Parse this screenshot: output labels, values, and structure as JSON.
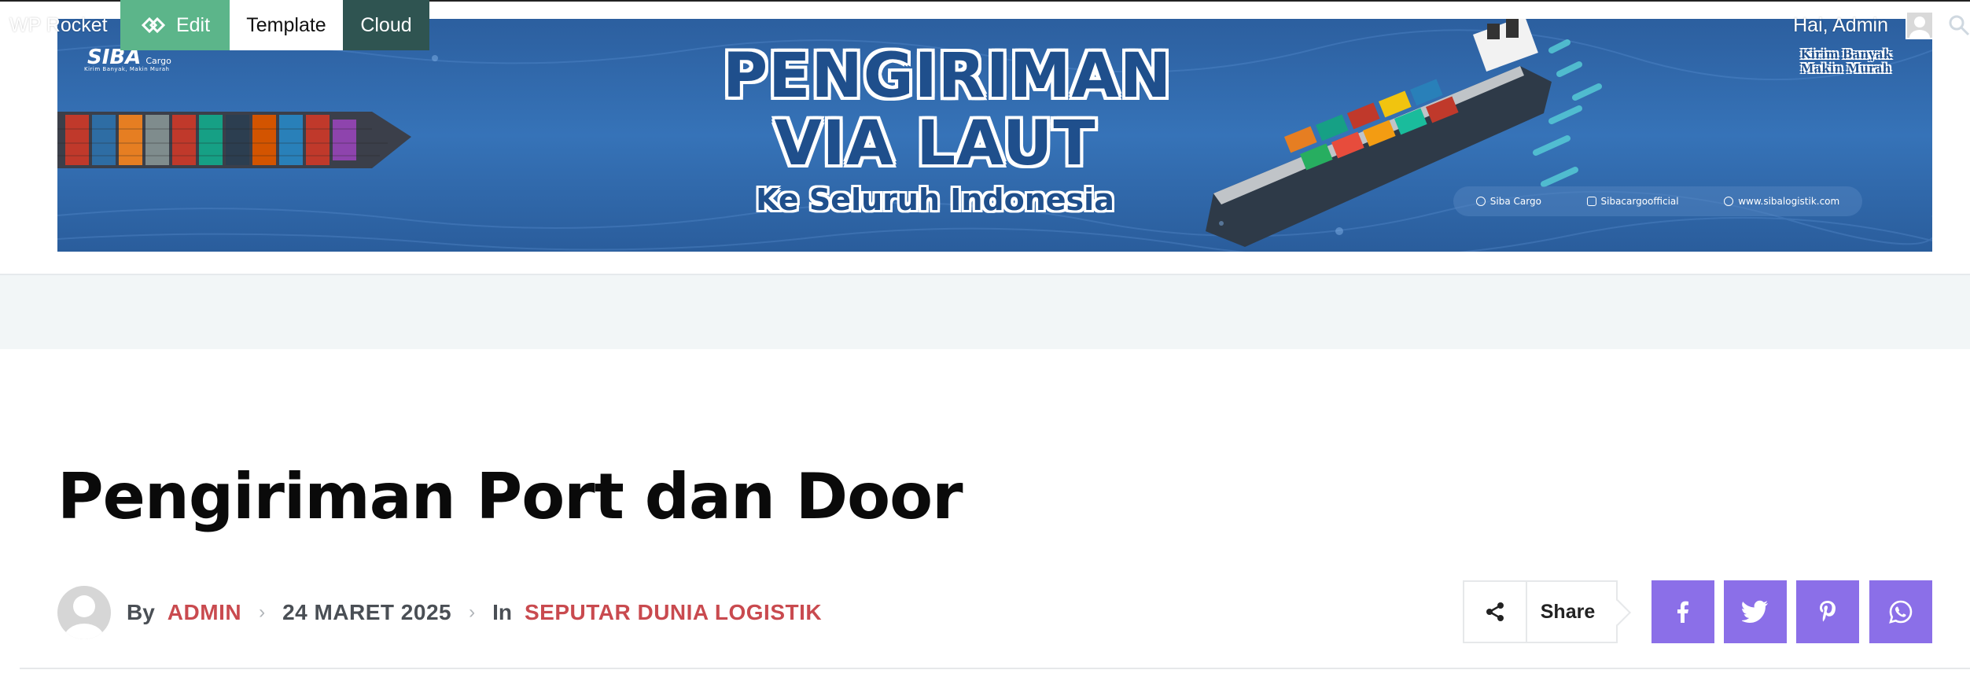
{
  "admin_bar": {
    "wp_rocket_label": "WP Rocket",
    "edit_label": "Edit",
    "template_label": "Template",
    "cloud_label": "Cloud",
    "greeting": "Hai, Admin"
  },
  "banner": {
    "logo_text": "SIBA",
    "logo_sub": "Cargo",
    "logo_tagline": "Kirim Banyak, Makin Murah",
    "title_line1": "PENGIRIMAN",
    "title_line2": "VIA LAUT",
    "subtitle": "Ke Seluruh Indonesia",
    "slogan_line1": "Kirim Banyak",
    "slogan_line2": "Makin Murah",
    "social": [
      {
        "icon": "facebook-icon",
        "label": "Siba Cargo"
      },
      {
        "icon": "instagram-icon",
        "label": "Sibacargoofficial"
      },
      {
        "icon": "globe-icon",
        "label": "www.sibalogistik.com"
      }
    ]
  },
  "post": {
    "title": "Pengiriman Port dan Door",
    "by_label": "By",
    "author": "ADMIN",
    "date": "24 MARET 2025",
    "in_label": "In",
    "category": "SEPUTAR DUNIA LOGISTIK"
  },
  "share": {
    "label": "Share",
    "buttons": [
      "facebook-icon",
      "twitter-icon",
      "pinterest-icon",
      "whatsapp-icon"
    ]
  },
  "colors": {
    "edit_bg": "#5cb58a",
    "cloud_bg": "#2f5451",
    "link": "#c94a4f",
    "social_bg": "#8b6fe8",
    "gray_band": "#f2f6f7"
  }
}
